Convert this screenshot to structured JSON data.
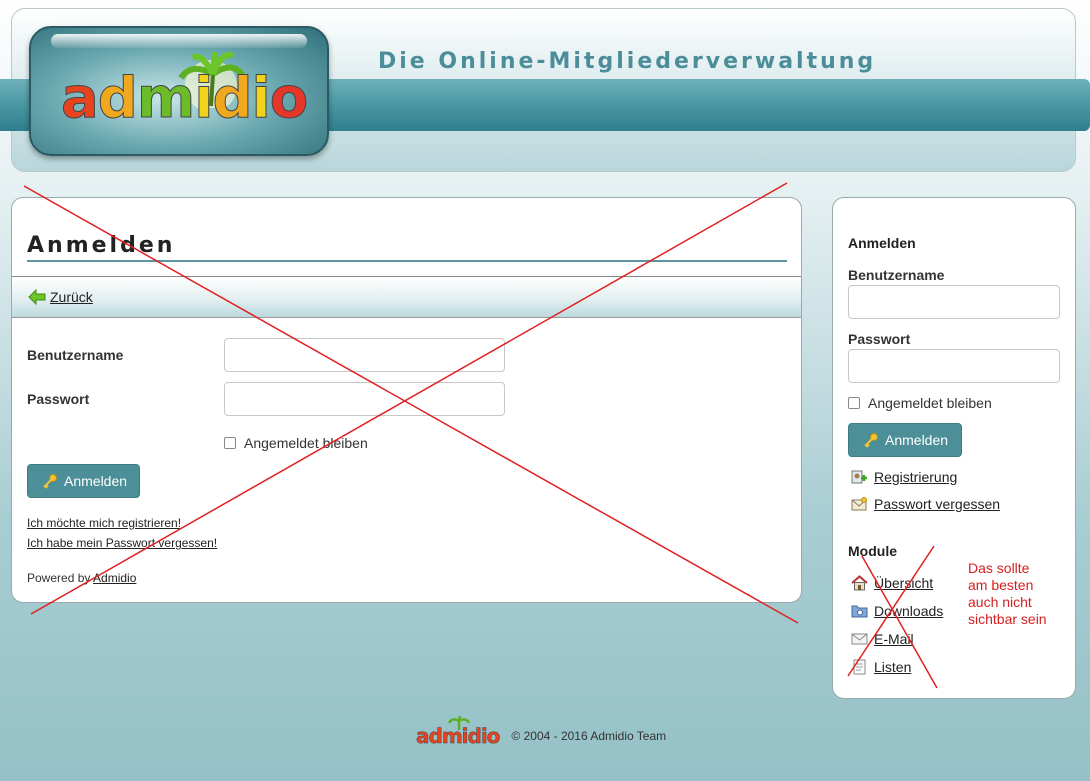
{
  "header": {
    "logo_letters": [
      "a",
      "d",
      "m",
      "i",
      "d",
      "i",
      "o"
    ],
    "tagline": "Die Online-Mitgliederverwaltung"
  },
  "main": {
    "title": "Anmelden",
    "back_link": "Zurück",
    "username_label": "Benutzername",
    "password_label": "Passwort",
    "remember_label": "Angemeldet bleiben",
    "login_button": "Anmelden",
    "register_link": "Ich möchte mich registrieren!",
    "forgot_link": "Ich habe mein Passwort vergessen!",
    "powered_prefix": "Powered by",
    "powered_link": "Admidio"
  },
  "sidebar": {
    "login_heading": "Anmelden",
    "username_label": "Benutzername",
    "password_label": "Passwort",
    "remember_label": "Angemeldet bleiben",
    "login_button": "Anmelden",
    "register_link": "Registrierung",
    "forgot_link": "Passwort vergessen",
    "modules_heading": "Module",
    "modules": [
      {
        "label": "Übersicht",
        "icon": "home-icon"
      },
      {
        "label": "Downloads",
        "icon": "folder-camera-icon"
      },
      {
        "label": "E-Mail",
        "icon": "envelope-icon"
      },
      {
        "label": "Listen",
        "icon": "list-icon"
      }
    ]
  },
  "annotation": {
    "lines": [
      "Das sollte",
      "am besten",
      "auch nicht",
      "sichtbar sein"
    ],
    "color": "#d42020"
  },
  "footer": {
    "logo": "admidio",
    "copyright": "© 2004 - 2016  Admidio Team"
  },
  "colors": {
    "accent": "#4c8f98",
    "header_band": "#4c9aa6",
    "strike_line": "#e02020"
  }
}
